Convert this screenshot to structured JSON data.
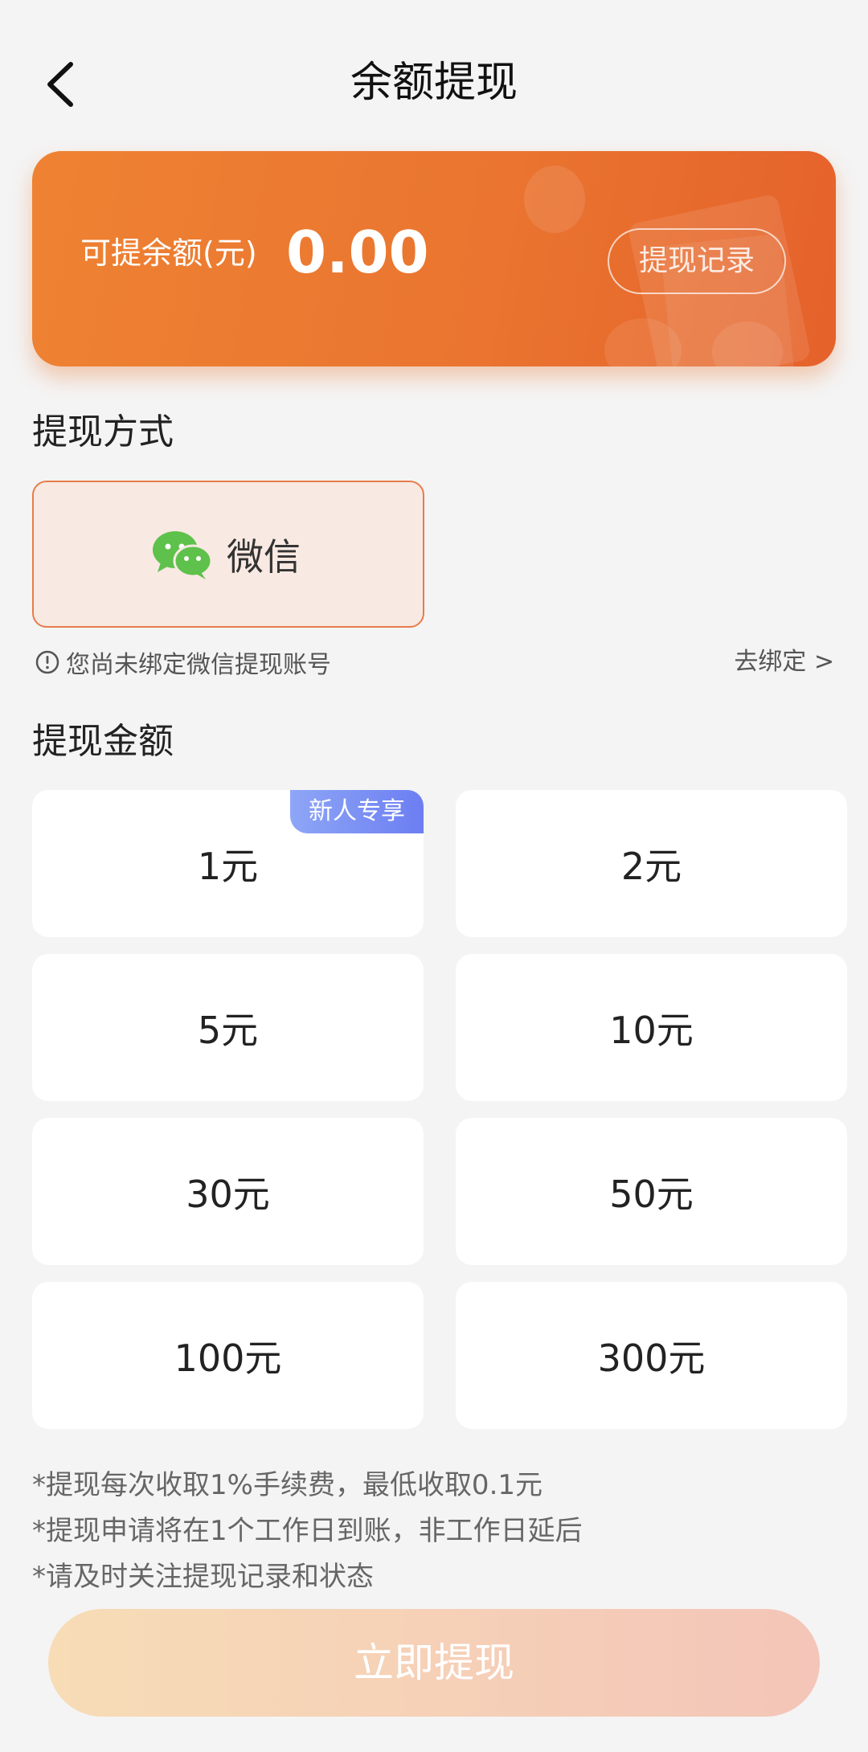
{
  "header": {
    "title": "余额提现"
  },
  "balance": {
    "label": "可提余额(元)",
    "value": "0.00",
    "record_button": "提现记录"
  },
  "method": {
    "section_title": "提现方式",
    "option_label": "微信",
    "hint": "您尚未绑定微信提现账号",
    "bind_link": "去绑定 >"
  },
  "amount": {
    "section_title": "提现金额",
    "badge": "新人专享",
    "options": [
      "1元",
      "2元",
      "5元",
      "10元",
      "30元",
      "50元",
      "100元",
      "300元"
    ]
  },
  "notes": [
    "*提现每次收取1%手续费，最低收取0.1元",
    "*提现申请将在1个工作日到账，非工作日延后",
    "*请及时关注提现记录和状态"
  ],
  "submit": {
    "label": "立即提现"
  },
  "colors": {
    "accent": "#ea7530",
    "wechat": "#5ec14b",
    "badge": "#7b8ff4"
  }
}
